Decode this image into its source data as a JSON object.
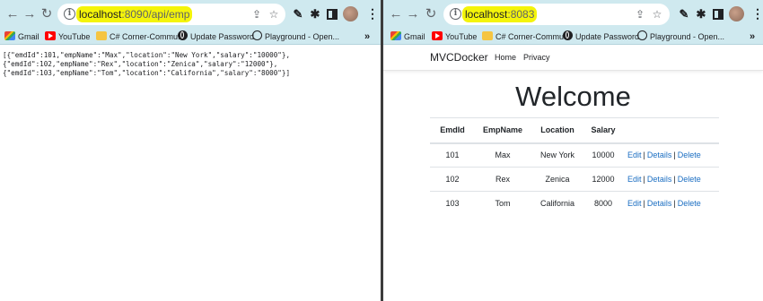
{
  "left_window": {
    "url_host": "localhost",
    "url_path": ":8090/api/emp",
    "json_lines": [
      "[{\"emdId\":101,\"empName\":\"Max\",\"location\":\"New York\",\"salary\":\"10000\"},",
      "{\"emdId\":102,\"empName\":\"Rex\",\"location\":\"Zenica\",\"salary\":\"12000\"},",
      "{\"emdId\":103,\"empName\":\"Tom\",\"location\":\"California\",\"salary\":\"8000\"}]"
    ]
  },
  "right_window": {
    "url_host": "localhost",
    "url_path": ":8083",
    "brand": "MVCDocker",
    "nav": [
      "Home",
      "Privacy"
    ],
    "heading": "Welcome",
    "table": {
      "headers": [
        "EmdId",
        "EmpName",
        "Location",
        "Salary",
        ""
      ],
      "rows": [
        {
          "id": "101",
          "name": "Max",
          "location": "New York",
          "salary": "10000"
        },
        {
          "id": "102",
          "name": "Rex",
          "location": "Zenica",
          "salary": "12000"
        },
        {
          "id": "103",
          "name": "Tom",
          "location": "California",
          "salary": "8000"
        }
      ],
      "actions": {
        "edit": "Edit",
        "details": "Details",
        "delete": "Delete",
        "separator": "|"
      }
    }
  },
  "bookmarks": {
    "gmail": "Gmail",
    "youtube": "YouTube",
    "csharp": "C# Corner-Commu...",
    "update_password": "Update Password",
    "playground": "Playground - Open...",
    "more": "»"
  },
  "icons": {
    "back": "←",
    "forward": "→",
    "reload": "↻",
    "info": "i",
    "share": "⇪",
    "star": "☆",
    "pen": "✎",
    "puzzle": "✱",
    "menu": "⋮"
  },
  "colors": {
    "toolbar": "#cfe9ef",
    "url_highlight": "#f4f40a",
    "link": "#1b6ec2"
  }
}
